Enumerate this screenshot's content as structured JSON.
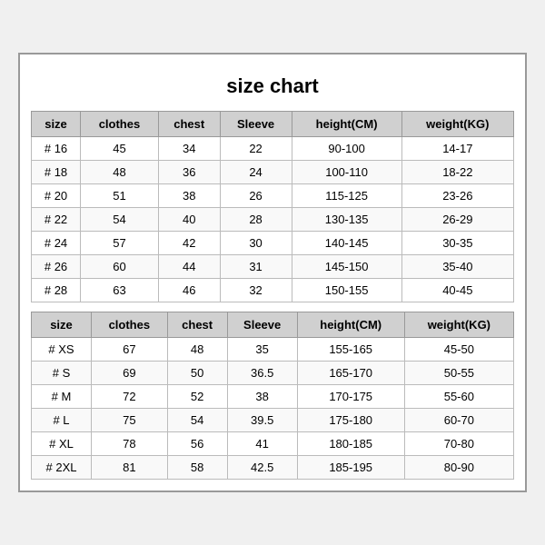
{
  "chart": {
    "title": "size chart",
    "headers": [
      "size",
      "clothes",
      "chest",
      "Sleeve",
      "height(CM)",
      "weight(KG)"
    ],
    "table1": [
      [
        "# 16",
        "45",
        "34",
        "22",
        "90-100",
        "14-17"
      ],
      [
        "# 18",
        "48",
        "36",
        "24",
        "100-110",
        "18-22"
      ],
      [
        "# 20",
        "51",
        "38",
        "26",
        "115-125",
        "23-26"
      ],
      [
        "# 22",
        "54",
        "40",
        "28",
        "130-135",
        "26-29"
      ],
      [
        "# 24",
        "57",
        "42",
        "30",
        "140-145",
        "30-35"
      ],
      [
        "# 26",
        "60",
        "44",
        "31",
        "145-150",
        "35-40"
      ],
      [
        "# 28",
        "63",
        "46",
        "32",
        "150-155",
        "40-45"
      ]
    ],
    "table2": [
      [
        "# XS",
        "67",
        "48",
        "35",
        "155-165",
        "45-50"
      ],
      [
        "# S",
        "69",
        "50",
        "36.5",
        "165-170",
        "50-55"
      ],
      [
        "# M",
        "72",
        "52",
        "38",
        "170-175",
        "55-60"
      ],
      [
        "# L",
        "75",
        "54",
        "39.5",
        "175-180",
        "60-70"
      ],
      [
        "# XL",
        "78",
        "56",
        "41",
        "180-185",
        "70-80"
      ],
      [
        "# 2XL",
        "81",
        "58",
        "42.5",
        "185-195",
        "80-90"
      ]
    ]
  }
}
